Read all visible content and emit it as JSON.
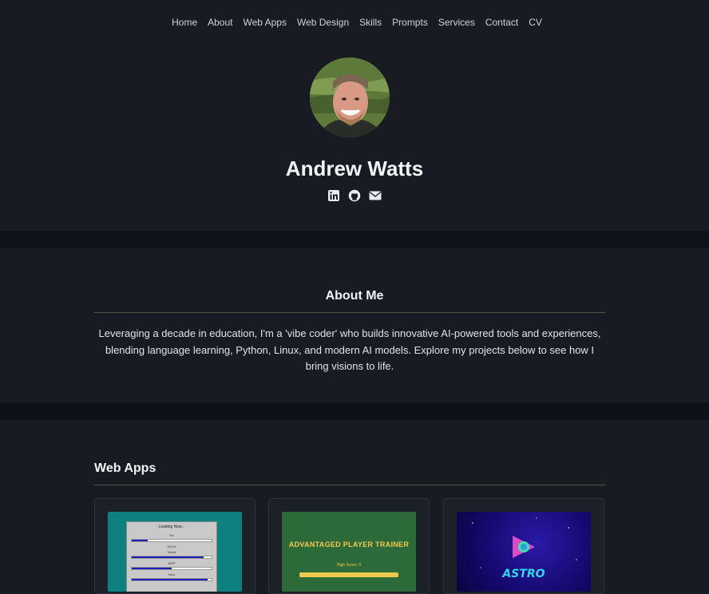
{
  "nav": {
    "items": [
      "Home",
      "About",
      "Web Apps",
      "Web Design",
      "Skills",
      "Prompts",
      "Services",
      "Contact",
      "CV"
    ]
  },
  "profile": {
    "name": "Andrew Watts",
    "avatar_icon": "profile-photo",
    "social_icons": [
      "linkedin-icon",
      "github-icon",
      "envelope-icon"
    ]
  },
  "about": {
    "title": "About Me",
    "text": "Leveraging a decade in education, I'm a 'vibe coder' who builds innovative AI-powered tools and experiences, blending language learning, Python, Linux, and modern AI models. Explore my projects below to see how I bring visions to life."
  },
  "webapps": {
    "title": "Web Apps",
    "cards": [
      {
        "thumb": "dialog-window-preview",
        "dialog_title": "Loading Now...",
        "lines": [
          "0%",
          "25.0%",
          "Week",
          "WEP",
          "Next"
        ]
      },
      {
        "thumb": "trainer-preview",
        "title": "ADVANTAGED PLAYER TRAINER",
        "subtitle": "High Score: 0"
      },
      {
        "thumb": "astro-game-preview",
        "title": "ASTRO"
      }
    ]
  },
  "colors": {
    "background": "#181c22",
    "band": "#0e1116",
    "text": "#e8eaed",
    "rule": "#4c5a4c"
  }
}
